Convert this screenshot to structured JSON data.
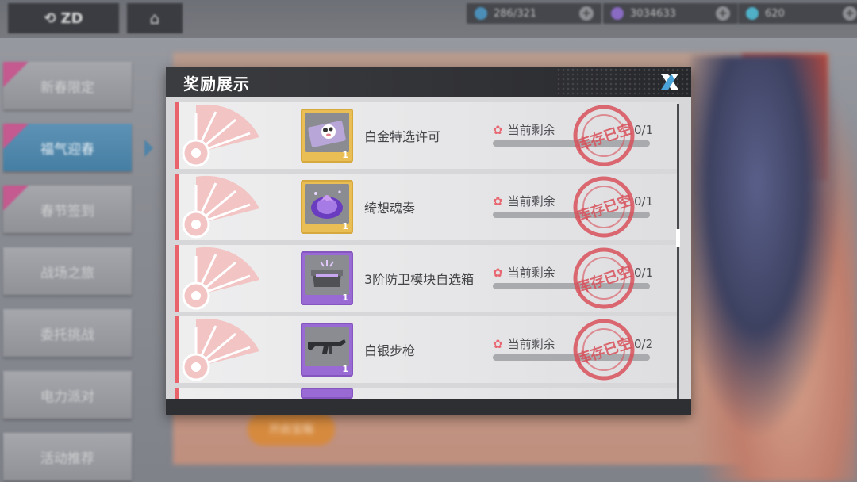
{
  "background": {
    "resources": [
      {
        "name": "energy",
        "value": "286/321",
        "color": "#4b8fb8"
      },
      {
        "name": "crystal",
        "value": "3034633",
        "color": "#8a6bc4"
      },
      {
        "name": "gem",
        "value": "620",
        "color": "#4fb0c8"
      }
    ],
    "side_tabs": [
      {
        "label": "新春限定",
        "active": false,
        "tag": true
      },
      {
        "label": "福气迎春",
        "active": true,
        "tag": true
      },
      {
        "label": "春节签到",
        "active": false,
        "tag": true
      },
      {
        "label": "战场之旅",
        "active": false,
        "tag": false
      },
      {
        "label": "委托挑战",
        "active": false,
        "tag": false
      },
      {
        "label": "电力派对",
        "active": false,
        "tag": false
      },
      {
        "label": "活动推荐",
        "active": false,
        "tag": false
      }
    ],
    "bottom_button_label": "开启宝箱",
    "colors": {
      "active_tab": "#4f86ab",
      "tag": "#c45a8f"
    }
  },
  "modal": {
    "title": "奖励展示",
    "remain_label": "当前剩余",
    "stamp_text": "库存已空",
    "items": [
      {
        "name": "白金特选许可",
        "count": "0/1",
        "qty": "1",
        "rarity": "gold",
        "icon": "card-cat-icon"
      },
      {
        "name": "绮想魂奏",
        "count": "0/1",
        "qty": "1",
        "rarity": "gold",
        "icon": "purple-flame-orb-icon"
      },
      {
        "name": "3阶防卫模块自选箱",
        "count": "0/1",
        "qty": "1",
        "rarity": "purple",
        "icon": "module-box-icon"
      },
      {
        "name": "白银步枪",
        "count": "0/2",
        "qty": "1",
        "rarity": "purple",
        "icon": "rifle-icon"
      }
    ],
    "colors": {
      "gold": "#e9be55",
      "purple": "#9a6ad4",
      "accent_red": "#e9636b",
      "stamp_red": "#d8505a",
      "close_blue": "#4aa3d8"
    }
  }
}
